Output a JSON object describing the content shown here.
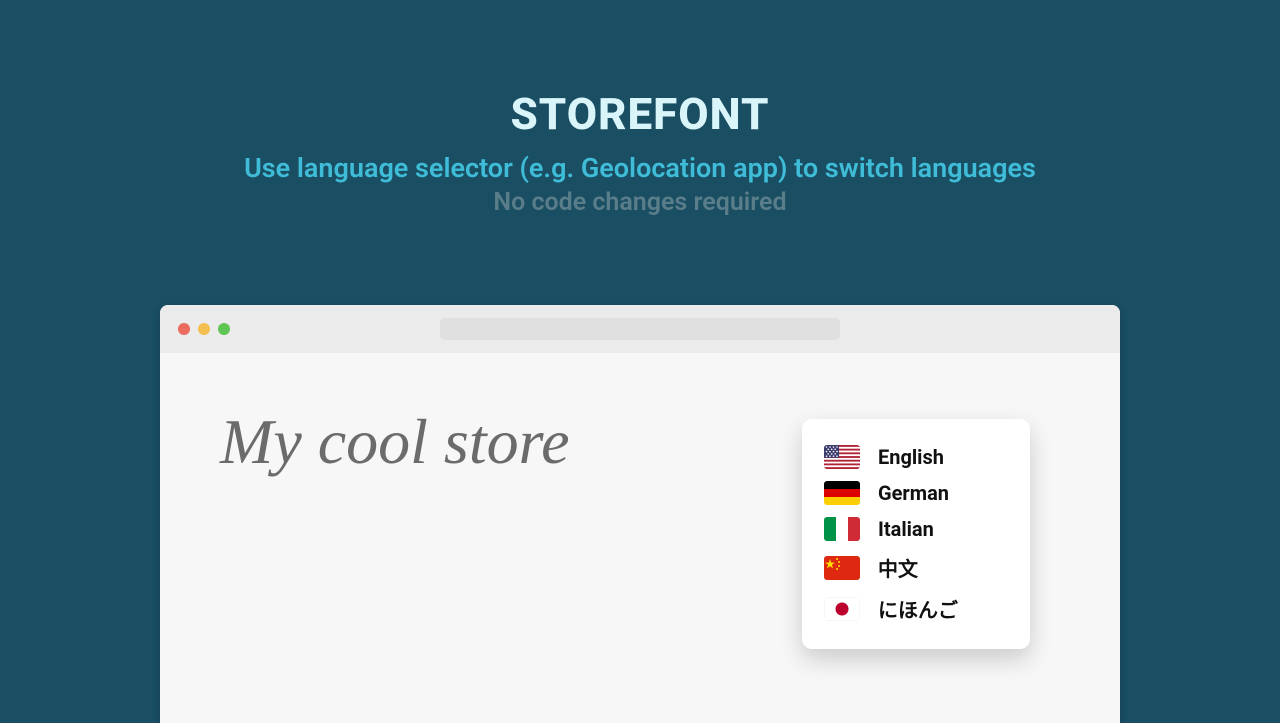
{
  "header": {
    "title": "STOREFONT",
    "subtitle": "Use language selector (e.g. Geolocation app) to switch languages",
    "note": "No code changes required"
  },
  "browser": {
    "store_title": "My cool store",
    "languages": [
      {
        "label": "English",
        "flag": "us"
      },
      {
        "label": "German",
        "flag": "de"
      },
      {
        "label": "Italian",
        "flag": "it"
      },
      {
        "label": "中文",
        "flag": "cn"
      },
      {
        "label": "にほんご",
        "flag": "jp"
      }
    ]
  }
}
